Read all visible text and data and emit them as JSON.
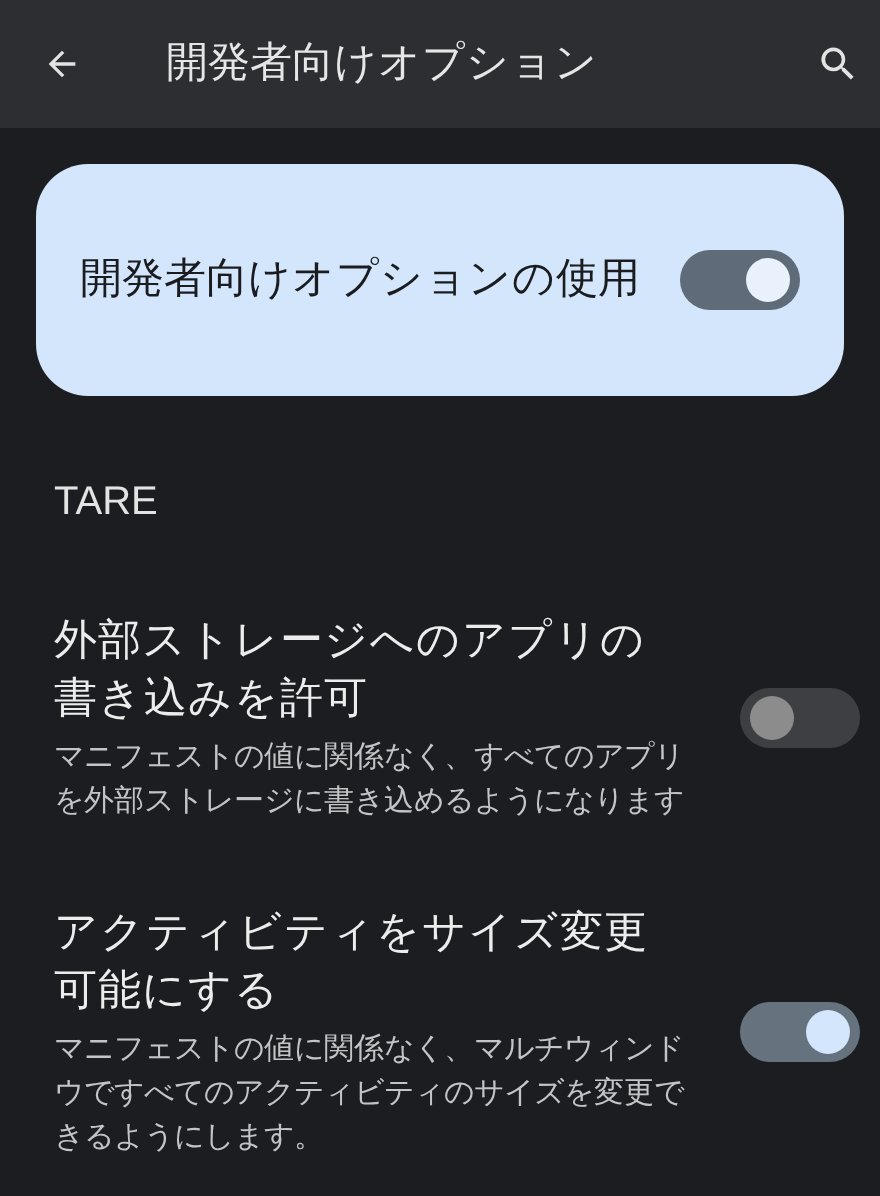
{
  "app_bar": {
    "title": "開発者向けオプション"
  },
  "main_switch": {
    "label": "開発者向けオプションの使用",
    "on": true
  },
  "section": {
    "title": "TARE"
  },
  "settings": [
    {
      "title": "外部ストレージへのアプリの書き込みを許可",
      "summary": "マニフェストの値に関係なく、すべてのアプリを外部ストレージに書き込めるようになります",
      "on": false
    },
    {
      "title": "アクティビティをサイズ変更可能にする",
      "summary": "マニフェストの値に関係なく、マルチウィンドウですべてのアクティビティのサイズを変更できるようにします。",
      "on": true
    }
  ]
}
